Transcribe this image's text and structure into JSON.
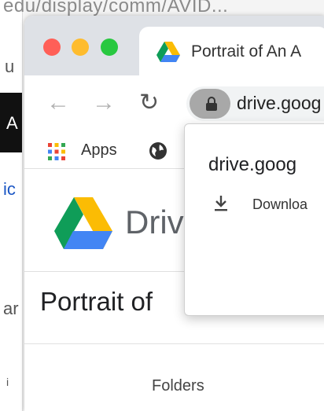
{
  "background": {
    "url_text": "edu/display/comm/AVID...",
    "letters": [
      "u",
      "A",
      "ic",
      "ar",
      "i"
    ]
  },
  "window": {
    "tab": {
      "title": "Portrait of An A",
      "icon": "google-drive-icon"
    },
    "controls": [
      "close",
      "minimize",
      "maximize"
    ],
    "toolbar": {
      "back_icon": "arrow-left-icon",
      "forward_icon": "arrow-right-icon",
      "reload_icon": "reload-icon",
      "lock_icon": "lock-icon",
      "address_text": "drive.goog"
    },
    "bookmarks": {
      "apps_label": "Apps",
      "globe_icon": "globe-icon"
    },
    "page": {
      "drive_word": "Drive",
      "doc_title": "Portrait of",
      "folders_label": "Folders"
    },
    "popup": {
      "host": "drive.goog",
      "download_label": "Downloa"
    }
  },
  "colors": {
    "close": "#ff5f57",
    "minimize": "#febc2e",
    "maximize": "#28c840",
    "titlebar": "#dee1e6"
  }
}
